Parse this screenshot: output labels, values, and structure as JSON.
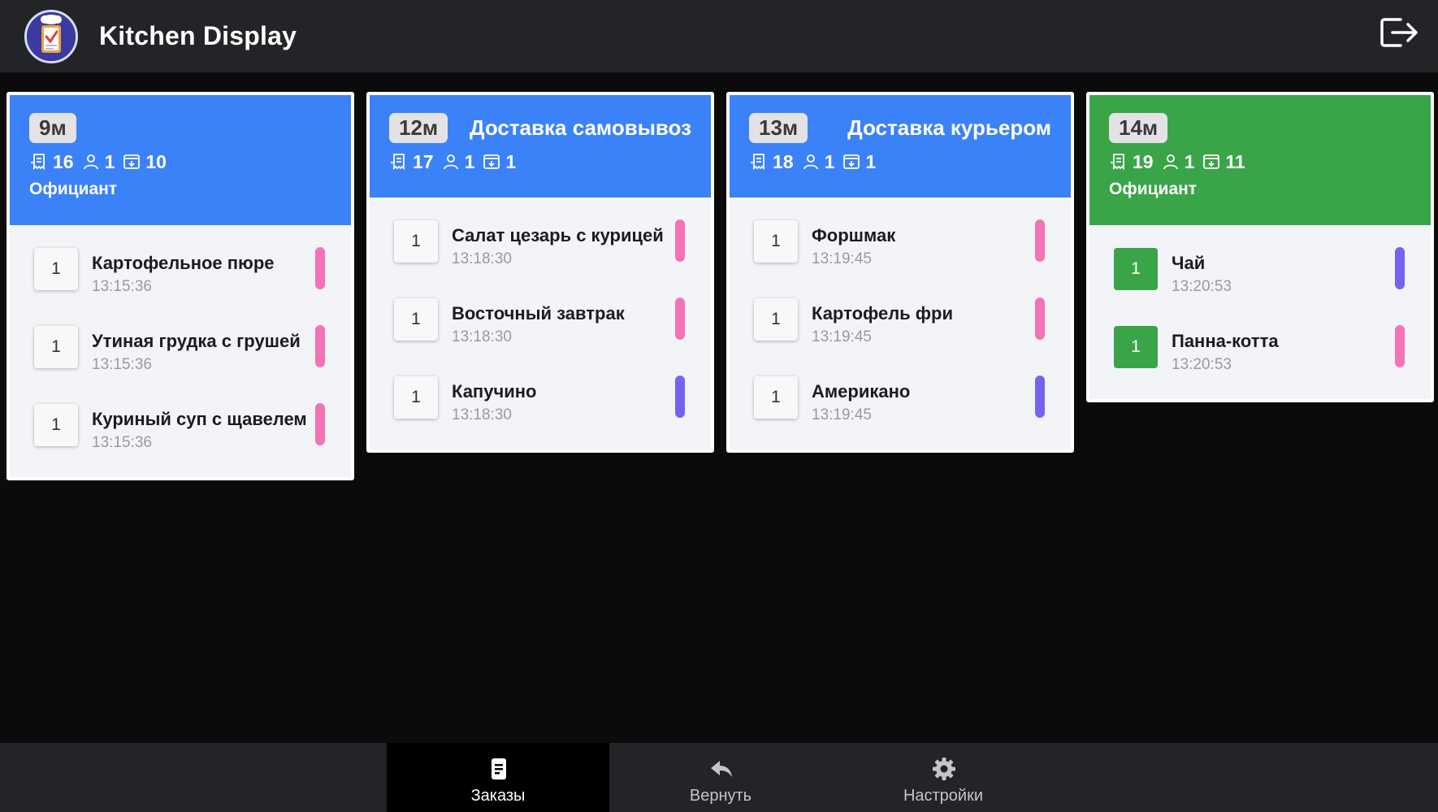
{
  "header": {
    "title": "Kitchen Display",
    "logo_icon": "chef-clipboard-icon",
    "logout_icon": "logout-icon"
  },
  "colors": {
    "header_bg": "#232427",
    "new_order": "#3b82f8",
    "ready_order": "#3aa449",
    "food_tag": "#f472b6",
    "drink_tag": "#7563f0"
  },
  "orders": [
    {
      "timer": "9м",
      "type": "",
      "check": "16",
      "guests": "1",
      "table": "10",
      "waiter": "Официант",
      "status": "new",
      "items": [
        {
          "qty": "1",
          "name": "Картофельное пюре",
          "time": "13:15:36",
          "tag": "food",
          "done": false
        },
        {
          "qty": "1",
          "name": "Утиная грудка с грушей",
          "time": "13:15:36",
          "tag": "food",
          "done": false
        },
        {
          "qty": "1",
          "name": "Куриный суп с щавелем",
          "time": "13:15:36",
          "tag": "food",
          "done": false
        }
      ]
    },
    {
      "timer": "12м",
      "type": "Доставка самовывоз",
      "check": "17",
      "guests": "1",
      "table": "1",
      "waiter": "",
      "status": "new",
      "items": [
        {
          "qty": "1",
          "name": "Салат цезарь с курицей",
          "time": "13:18:30",
          "tag": "food",
          "done": false
        },
        {
          "qty": "1",
          "name": "Восточный завтрак",
          "time": "13:18:30",
          "tag": "food",
          "done": false
        },
        {
          "qty": "1",
          "name": "Капучино",
          "time": "13:18:30",
          "tag": "drink",
          "done": false
        }
      ]
    },
    {
      "timer": "13м",
      "type": "Доставка курьером",
      "check": "18",
      "guests": "1",
      "table": "1",
      "waiter": "",
      "status": "new",
      "items": [
        {
          "qty": "1",
          "name": "Форшмак",
          "time": "13:19:45",
          "tag": "food",
          "done": false
        },
        {
          "qty": "1",
          "name": "Картофель фри",
          "time": "13:19:45",
          "tag": "food",
          "done": false
        },
        {
          "qty": "1",
          "name": "Американо",
          "time": "13:19:45",
          "tag": "drink",
          "done": false
        }
      ]
    },
    {
      "timer": "14м",
      "type": "",
      "check": "19",
      "guests": "1",
      "table": "11",
      "waiter": "Официант",
      "status": "ready",
      "items": [
        {
          "qty": "1",
          "name": "Чай",
          "time": "13:20:53",
          "tag": "drink",
          "done": true
        },
        {
          "qty": "1",
          "name": "Панна-котта",
          "time": "13:20:53",
          "tag": "food",
          "done": true
        }
      ]
    }
  ],
  "nav": [
    {
      "label": "Заказы",
      "icon": "orders-icon",
      "active": true
    },
    {
      "label": "Вернуть",
      "icon": "return-icon",
      "active": false
    },
    {
      "label": "Настройки",
      "icon": "settings-icon",
      "active": false
    }
  ]
}
